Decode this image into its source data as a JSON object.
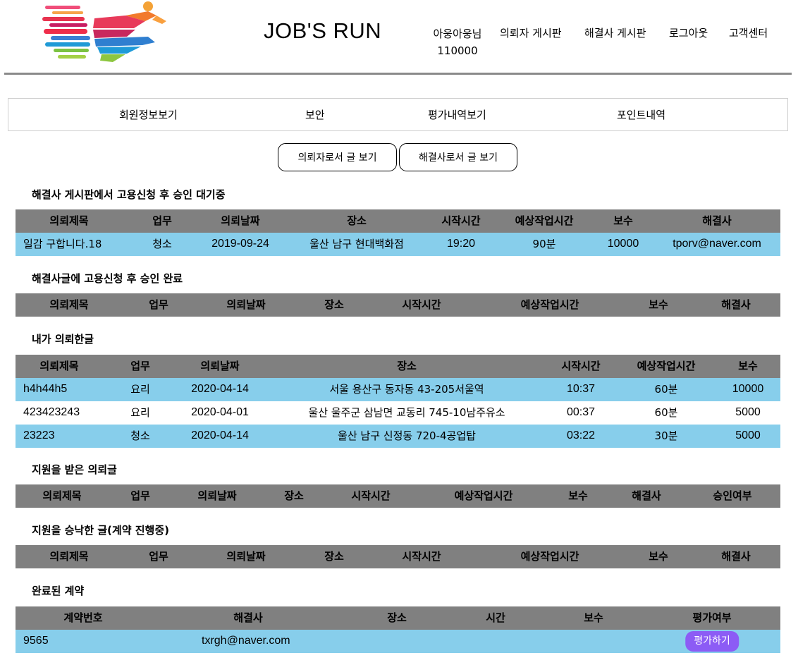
{
  "header": {
    "title": "JOB'S RUN",
    "user_name": "아웅아웅님",
    "user_points": "110000",
    "nav": [
      "의뢰자 게시판",
      "해결사 게시판",
      "로그아웃",
      "고객센터"
    ]
  },
  "subnav": [
    "회원정보보기",
    "보안",
    "평가내역보기",
    "포인트내역"
  ],
  "toggles": [
    "의뢰자로서 글 보기",
    "해결사로서 글 보기"
  ],
  "colors": {
    "header_row": "#808080",
    "row_highlight": "#87ceeb",
    "rate_button": "#8c5cf5"
  },
  "sections": {
    "pending": {
      "title": "해결사 게시판에서 고용신청 후 승인 대기중",
      "headers": [
        "의뢰제목",
        "업무",
        "의뢰날짜",
        "장소",
        "시작시간",
        "예상작업시간",
        "보수",
        "해결사"
      ],
      "rows": [
        [
          "일감 구합니다.18",
          "청소",
          "2019-09-24",
          "울산 남구 현대백화점",
          "19:20",
          "90분",
          "10000",
          "tporv@naver.com"
        ]
      ]
    },
    "approved": {
      "title": "해결사글에 고용신청 후 승인 완료",
      "headers": [
        "의뢰제목",
        "업무",
        "의뢰날짜",
        "장소",
        "시작시간",
        "예상작업시간",
        "보수",
        "해결사"
      ],
      "rows": []
    },
    "my_requests": {
      "title": "내가 의뢰한글",
      "headers": [
        "의뢰제목",
        "업무",
        "의뢰날짜",
        "장소",
        "시작시간",
        "예상작업시간",
        "보수"
      ],
      "rows": [
        [
          "h4h44h5",
          "요리",
          "2020-04-14",
          "서울 용산구 동자동 43-205서울역",
          "10:37",
          "60분",
          "10000"
        ],
        [
          "423423243",
          "요리",
          "2020-04-01",
          "울산 울주군 삼남면 교동리 745-10남주유소",
          "00:37",
          "60분",
          "5000"
        ],
        [
          "23223",
          "청소",
          "2020-04-14",
          "울산 남구 신정동 720-4공업탑",
          "03:22",
          "30분",
          "5000"
        ]
      ]
    },
    "applied": {
      "title": "지원을 받은 의뢰글",
      "headers": [
        "의뢰제목",
        "업무",
        "의뢰날짜",
        "장소",
        "시작시간",
        "예상작업시간",
        "보수",
        "해결사",
        "승인여부"
      ],
      "rows": []
    },
    "accepted": {
      "title": "지원을 승낙한 글(계약 진행중)",
      "headers": [
        "의뢰제목",
        "업무",
        "의뢰날짜",
        "장소",
        "시작시간",
        "예상작업시간",
        "보수",
        "해결사"
      ],
      "rows": []
    },
    "completed": {
      "title": "완료된 계약",
      "headers": [
        "계약번호",
        "해결사",
        "장소",
        "시간",
        "보수",
        "평가여부"
      ],
      "rows": [
        {
          "contract_no": "9565",
          "solver": "txrgh@naver.com",
          "rate_label": "평가하기"
        }
      ]
    }
  }
}
